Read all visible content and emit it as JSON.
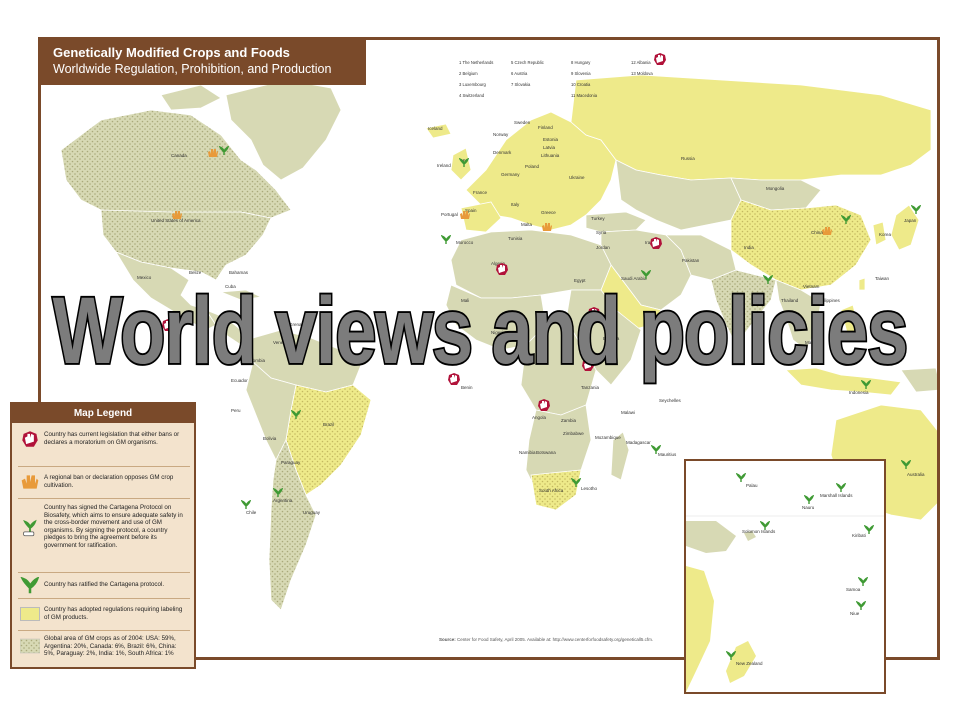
{
  "map": {
    "title": "Genetically Modified Crops and Foods",
    "subtitle": "Worldwide Regulation, Prohibition, and Production",
    "source_label": "Source:",
    "source_text": "Center for Food Safety, April 2005. Available at: http://www.centerforfoodsafety.org/geneticall5.cfm."
  },
  "countries": [
    {
      "id": "canada",
      "label": "Canada"
    },
    {
      "id": "usa",
      "label": "United States of America"
    },
    {
      "id": "mexico",
      "label": "Mexico"
    },
    {
      "id": "belize",
      "label": "Belize"
    },
    {
      "id": "bahamas",
      "label": "Bahamas"
    },
    {
      "id": "venezuela",
      "label": "Venezuela"
    },
    {
      "id": "colombia",
      "label": "Colombia"
    },
    {
      "id": "ecuador",
      "label": "Ecuador"
    },
    {
      "id": "peru",
      "label": "Peru"
    },
    {
      "id": "brazil",
      "label": "Brazil"
    },
    {
      "id": "bolivia",
      "label": "Bolivia"
    },
    {
      "id": "paraguay",
      "label": "Paraguay"
    },
    {
      "id": "chile",
      "label": "Chile"
    },
    {
      "id": "argentina",
      "label": "Argentina"
    },
    {
      "id": "uruguay",
      "label": "Uruguay"
    },
    {
      "id": "iceland",
      "label": "Iceland"
    },
    {
      "id": "ireland",
      "label": "Ireland"
    },
    {
      "id": "uk",
      "label": "UK"
    },
    {
      "id": "norway",
      "label": "Norway"
    },
    {
      "id": "sweden",
      "label": "Sweden"
    },
    {
      "id": "finland",
      "label": "Finland"
    },
    {
      "id": "estonia",
      "label": "Estonia"
    },
    {
      "id": "latvia",
      "label": "Latvia"
    },
    {
      "id": "lithuania",
      "label": "Lithuania"
    },
    {
      "id": "denmark",
      "label": "Denmark"
    },
    {
      "id": "germany",
      "label": "Germany"
    },
    {
      "id": "poland",
      "label": "Poland"
    },
    {
      "id": "france",
      "label": "France"
    },
    {
      "id": "spain",
      "label": "Spain"
    },
    {
      "id": "portugal",
      "label": "Portugal"
    },
    {
      "id": "italy",
      "label": "Italy"
    },
    {
      "id": "greece",
      "label": "Greece"
    },
    {
      "id": "turkey",
      "label": "Turkey"
    },
    {
      "id": "ukraine",
      "label": "Ukraine"
    },
    {
      "id": "russia",
      "label": "Russia"
    },
    {
      "id": "mongolia",
      "label": "Mongolia"
    },
    {
      "id": "china",
      "label": "China"
    },
    {
      "id": "japan",
      "label": "Japan"
    },
    {
      "id": "korea",
      "label": "Korea"
    },
    {
      "id": "india",
      "label": "India"
    },
    {
      "id": "pakistan",
      "label": "Pakistan"
    },
    {
      "id": "iran",
      "label": "Iran"
    },
    {
      "id": "saudi",
      "label": "Saudi Arabia"
    },
    {
      "id": "egypt",
      "label": "Egypt"
    },
    {
      "id": "algeria",
      "label": "Algeria"
    },
    {
      "id": "morocco",
      "label": "Morocco"
    },
    {
      "id": "tunisia",
      "label": "Tunisia"
    },
    {
      "id": "malta",
      "label": "Malta"
    },
    {
      "id": "mali",
      "label": "Mali"
    },
    {
      "id": "nigeria",
      "label": "Nigeria"
    },
    {
      "id": "ethiopia",
      "label": "Ethiopia"
    },
    {
      "id": "kenya",
      "label": "Kenya"
    },
    {
      "id": "tanzania",
      "label": "Tanzania"
    },
    {
      "id": "angola",
      "label": "Angola"
    },
    {
      "id": "zambia",
      "label": "Zambia"
    },
    {
      "id": "zimbabwe",
      "label": "Zimbabwe"
    },
    {
      "id": "mozambique",
      "label": "Mozambique"
    },
    {
      "id": "botswana",
      "label": "Botswana"
    },
    {
      "id": "namibia",
      "label": "Namibia"
    },
    {
      "id": "south_africa",
      "label": "South Africa"
    },
    {
      "id": "lesotho",
      "label": "Lesotho"
    },
    {
      "id": "madagascar",
      "label": "Madagascar"
    },
    {
      "id": "mauritius",
      "label": "Mauritius"
    },
    {
      "id": "seychelles",
      "label": "Seychelles"
    },
    {
      "id": "malawi",
      "label": "Malawi"
    },
    {
      "id": "benin",
      "label": "Benin"
    },
    {
      "id": "syria",
      "label": "Syria"
    },
    {
      "id": "jordan",
      "label": "Jordan"
    },
    {
      "id": "thailand",
      "label": "Thailand"
    },
    {
      "id": "vietnam",
      "label": "Vietnam"
    },
    {
      "id": "philippines",
      "label": "Philippines"
    },
    {
      "id": "indonesia",
      "label": "Indonesia"
    },
    {
      "id": "malaysia",
      "label": "Malaysia"
    },
    {
      "id": "taiwan",
      "label": "Taiwan"
    },
    {
      "id": "australia",
      "label": "Australia"
    },
    {
      "id": "cuba",
      "label": "Cuba"
    },
    {
      "id": "grenada",
      "label": "Grenada"
    }
  ],
  "eu_key": [
    {
      "n": "1",
      "label": "The Netherlands"
    },
    {
      "n": "2",
      "label": "Belgium"
    },
    {
      "n": "3",
      "label": "Luxembourg"
    },
    {
      "n": "4",
      "label": "Switzerland"
    },
    {
      "n": "5",
      "label": "Czech Republic"
    },
    {
      "n": "6",
      "label": "Austria"
    },
    {
      "n": "7",
      "label": "Slovakia"
    },
    {
      "n": "8",
      "label": "Hungary"
    },
    {
      "n": "9",
      "label": "Slovenia"
    },
    {
      "n": "10",
      "label": "Croatia"
    },
    {
      "n": "11",
      "label": "Macedonia"
    },
    {
      "n": "12",
      "label": "Albania"
    },
    {
      "n": "13",
      "label": "Moldova"
    }
  ],
  "legend": {
    "title": "Map Legend",
    "items": [
      {
        "icon": "ban-hand-icon",
        "text": "Country has current legislation that either bans or declares a moratorium on GM organisms."
      },
      {
        "icon": "regional-ban-hand-icon",
        "text": "A regional ban or declaration opposes GM crop cultivation."
      },
      {
        "icon": "cartagena-signed-icon",
        "text": "Country has signed the Cartagena Protocol on Biosafety, which aims to ensure adequate safety in the cross-border movement and use of GM organisms. By signing the protocol, a country pledges to bring the agreement before its government for ratification."
      },
      {
        "icon": "cartagena-ratified-icon",
        "text": "Country has ratified the Cartagena protocol."
      },
      {
        "icon": "labeling-swatch",
        "text": "Country has adopted regulations requiring labeling of GM products."
      },
      {
        "icon": "gm-area-swatch",
        "text": "Global area of GM crops as of 2004: USA: 59%, Argentina: 20%, Canada: 6%, Brazil: 6%, China: 5%, Paraguay: 2%, India: 1%, South Africa: 1%"
      }
    ]
  },
  "inset": {
    "labels": [
      {
        "id": "palau",
        "label": "Palau"
      },
      {
        "id": "marshall",
        "label": "Marshall Islands"
      },
      {
        "id": "nauru",
        "label": "Nauru"
      },
      {
        "id": "solomon",
        "label": "Solomon Islands"
      },
      {
        "id": "kiribati",
        "label": "Kiribati"
      },
      {
        "id": "samoa",
        "label": "Samoa"
      },
      {
        "id": "niue",
        "label": "Niue"
      },
      {
        "id": "nz",
        "label": "New Zealand"
      }
    ]
  },
  "overlay_title": "World views and policies",
  "colors": {
    "frame_brown": "#7a4a2a",
    "land_gray": "#d7d9b4",
    "labeling_yellow": "#eeea8a",
    "ocean": "#ffffff",
    "legend_bg": "#f3e3cd",
    "ban_red": "#b1123a",
    "regional_orange": "#e89a3a",
    "ratified_green": "#3f9a34"
  }
}
